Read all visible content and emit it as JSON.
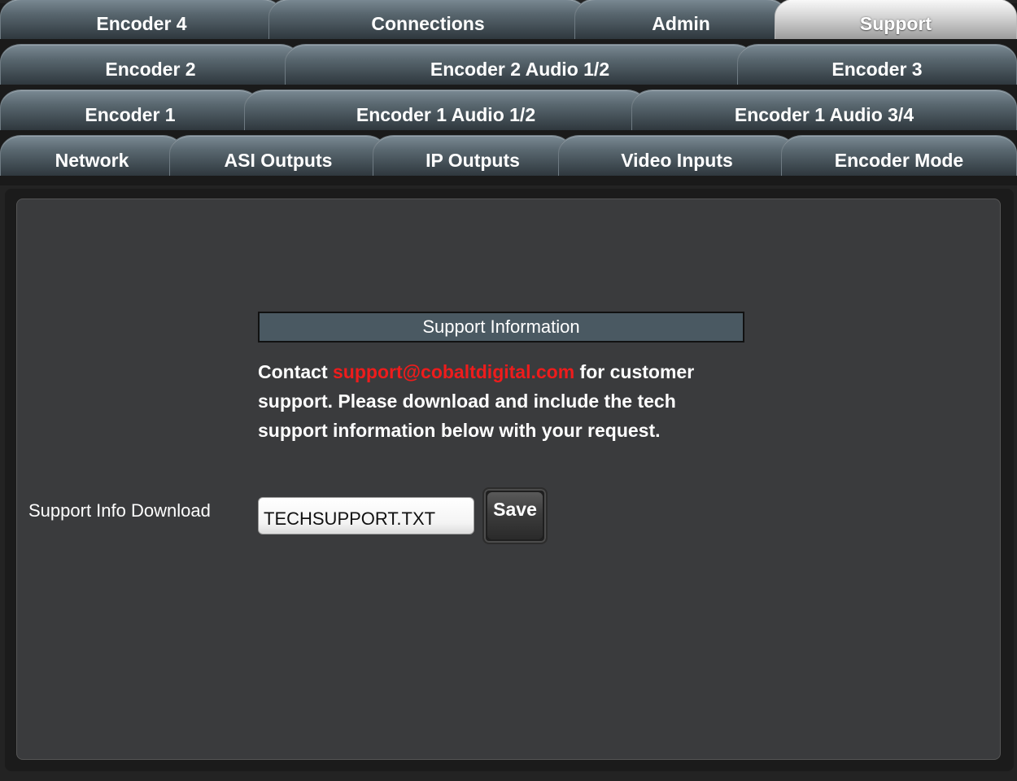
{
  "tabs": {
    "row1": [
      {
        "label": "Encoder 4"
      },
      {
        "label": "Connections"
      },
      {
        "label": "Admin"
      },
      {
        "label": "Support",
        "active": true
      }
    ],
    "row2": [
      {
        "label": "Encoder 2"
      },
      {
        "label": "Encoder 2 Audio 1/2"
      },
      {
        "label": "Encoder 3"
      }
    ],
    "row3": [
      {
        "label": "Encoder 1"
      },
      {
        "label": "Encoder 1 Audio 1/2"
      },
      {
        "label": "Encoder 1 Audio 3/4"
      }
    ],
    "row4": [
      {
        "label": "Network"
      },
      {
        "label": "ASI Outputs"
      },
      {
        "label": "IP Outputs"
      },
      {
        "label": "Video Inputs"
      },
      {
        "label": "Encoder Mode"
      }
    ]
  },
  "support": {
    "section_title": "Support Information",
    "contact_prefix": "Contact ",
    "email": "support@cobaltdigital.com",
    "contact_suffix": " for customer support. Please download and include the tech support information below with your request.",
    "download_label": "Support Info Download",
    "filename": "TECHSUPPORT.TXT",
    "save_label": "Save"
  },
  "colors": {
    "email": "#ee1c1c",
    "panel": "#3a3b3d",
    "section_header_bg": "#4a5962"
  }
}
